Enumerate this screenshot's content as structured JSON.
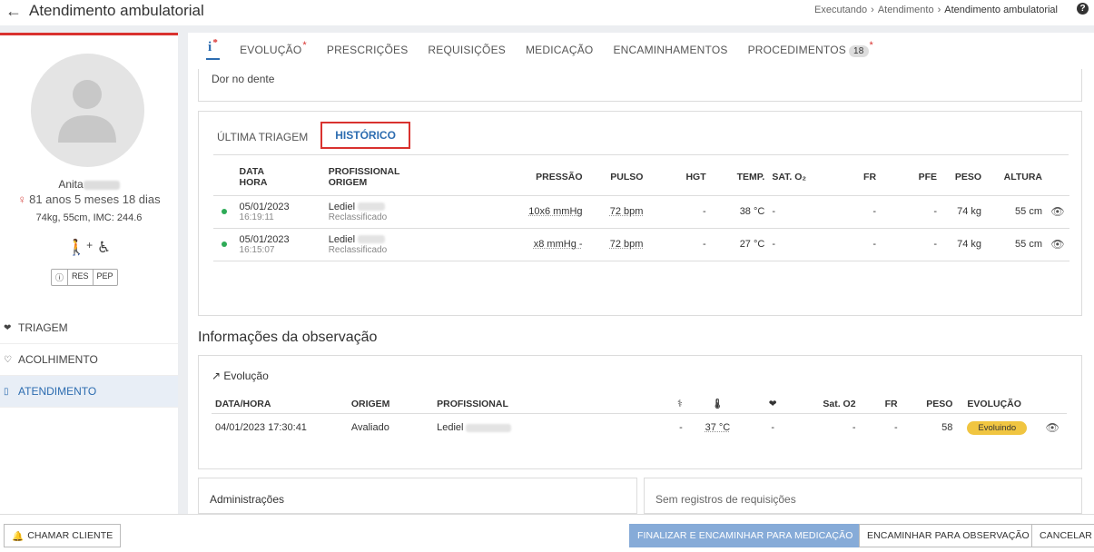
{
  "header": {
    "title": "Atendimento ambulatorial",
    "breadcrumb": [
      "Executando",
      "Atendimento",
      "Atendimento ambulatorial"
    ]
  },
  "patient": {
    "name": "Anita",
    "age": "81 anos 5 meses 18 dias",
    "vitals": "74kg, 55cm, IMC: 244.6",
    "buttons": [
      "ⓘ",
      "RES",
      "PEP"
    ]
  },
  "sidebar": {
    "items": [
      {
        "label": "TRIAGEM",
        "icon": "heart-pulse-icon"
      },
      {
        "label": "ACOLHIMENTO",
        "icon": "heart-outline-icon"
      },
      {
        "label": "ATENDIMENTO",
        "icon": "clipboard-icon"
      }
    ]
  },
  "tabs": {
    "info": "i",
    "items": [
      "EVOLUÇÃO",
      "PRESCRIÇÕES",
      "REQUISIÇÕES",
      "MEDICAÇÃO",
      "ENCAMINHAMENTOS",
      "PROCEDIMENTOS"
    ],
    "procedures_count": "18"
  },
  "chief_complaint": "Dor no dente",
  "triage": {
    "tabs": [
      "ÚLTIMA TRIAGEM",
      "HISTÓRICO"
    ],
    "headers": {
      "date_line1": "DATA",
      "date_line2": "HORA",
      "prof_line1": "PROFISSIONAL",
      "prof_line2": "ORIGEM",
      "pressao": "PRESSÃO",
      "pulso": "PULSO",
      "hgt": "HGT",
      "temp": "TEMP.",
      "sat": "SAT. O₂",
      "fr": "FR",
      "pfe": "PFE",
      "peso": "PESO",
      "altura": "ALTURA"
    },
    "rows": [
      {
        "date": "05/01/2023",
        "time": "16:19:11",
        "prof": "Lediel",
        "origin": "Reclassificado",
        "pressao": "10x6 mmHg",
        "pulso": "72 bpm",
        "hgt": "-",
        "temp": "38 °C",
        "sat": "-",
        "fr": "-",
        "pfe": "-",
        "peso": "74 kg",
        "altura": "55 cm"
      },
      {
        "date": "05/01/2023",
        "time": "16:15:07",
        "prof": "Lediel",
        "origin": "Reclassificado",
        "pressao": "x8 mmHg -",
        "pulso": "72 bpm",
        "hgt": "-",
        "temp": "27 °C",
        "sat": "-",
        "fr": "-",
        "pfe": "-",
        "peso": "74 kg",
        "altura": "55 cm"
      }
    ]
  },
  "observation": {
    "title": "Informações da observação",
    "subtitle": "Evolução",
    "headers": {
      "datahora": "DATA/HORA",
      "origem": "ORIGEM",
      "prof": "PROFISSIONAL",
      "sat": "Sat. O2",
      "fr": "FR",
      "peso": "PESO",
      "evolucao": "EVOLUÇÃO"
    },
    "row": {
      "datahora": "04/01/2023 17:30:41",
      "origem": "Avaliado",
      "prof": "Lediel",
      "pa": "-",
      "temp": "37 °C",
      "hr": "-",
      "sat": "-",
      "fr": "-",
      "peso": "58",
      "evolucao": "Evoluindo"
    }
  },
  "cards": {
    "adm": "Administrações",
    "req": "Sem registros de requisições"
  },
  "footer": {
    "call": "CHAMAR CLIENTE",
    "finish": "FINALIZAR E ENCAMINHAR PARA MEDICAÇÃO",
    "obs": "ENCAMINHAR PARA OBSERVAÇÃO",
    "cancel": "CANCELAR"
  },
  "colors": {
    "accent": "#2c6cb0",
    "alert": "#d9322f",
    "badge": "#f0c541",
    "primary_btn": "#86abd8"
  }
}
